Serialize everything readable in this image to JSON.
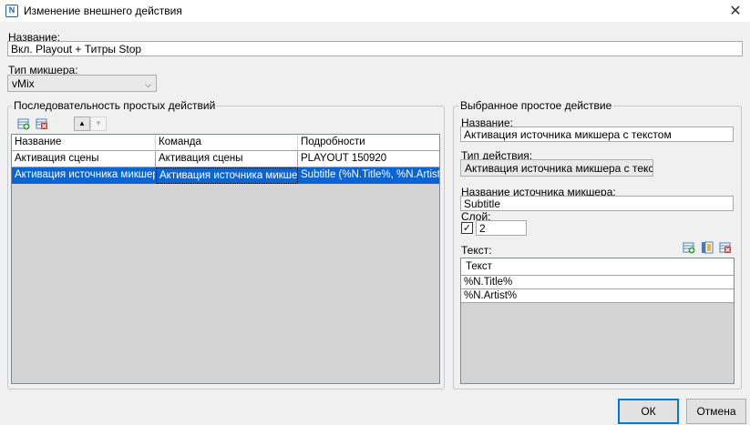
{
  "window": {
    "title": "Изменение внешнего действия",
    "close_glyph": "✕",
    "app_icon_glyph": "N"
  },
  "name_field": {
    "label": "Название:",
    "value": "Вкл. Playout + Титры Stop"
  },
  "mixer_type": {
    "label": "Тип микшера:",
    "value": "vMix"
  },
  "sequence": {
    "legend": "Последовательность простых действий",
    "toolbar": {
      "add_icon": "add-row-icon",
      "delete_icon": "delete-row-icon",
      "up_glyph": "▲",
      "down_glyph": "▼"
    },
    "columns": [
      "Название",
      "Команда",
      "Подробности"
    ],
    "rows": [
      [
        "Активация сцены",
        "Активация сцены",
        "PLAYOUT 150920"
      ],
      [
        "Активация источника микшера с",
        "Активация источника микшера с",
        "Subtitle (%N.Title%, %N.Artist%)"
      ]
    ]
  },
  "selected": {
    "legend": "Выбранное простое действие",
    "name_label": "Название:",
    "name_value": "Активация источника микшера с текстом",
    "action_type_label": "Тип действия:",
    "action_type_value": "Активация источника микшера с текстом",
    "source_label": "Название источника микшера:",
    "source_value": "Subtitle",
    "layer_label": "Слой:",
    "layer_checked_glyph": "✓",
    "layer_value": "2",
    "text_label": "Текст:",
    "text_column": "Текст",
    "text_rows": [
      "%N.Title%",
      "%N.Artist%"
    ]
  },
  "buttons": {
    "ok": "ОК",
    "cancel": "Отмена"
  },
  "colors": {
    "selection": "#0a64d2",
    "default_button_border": "#0078d7"
  }
}
